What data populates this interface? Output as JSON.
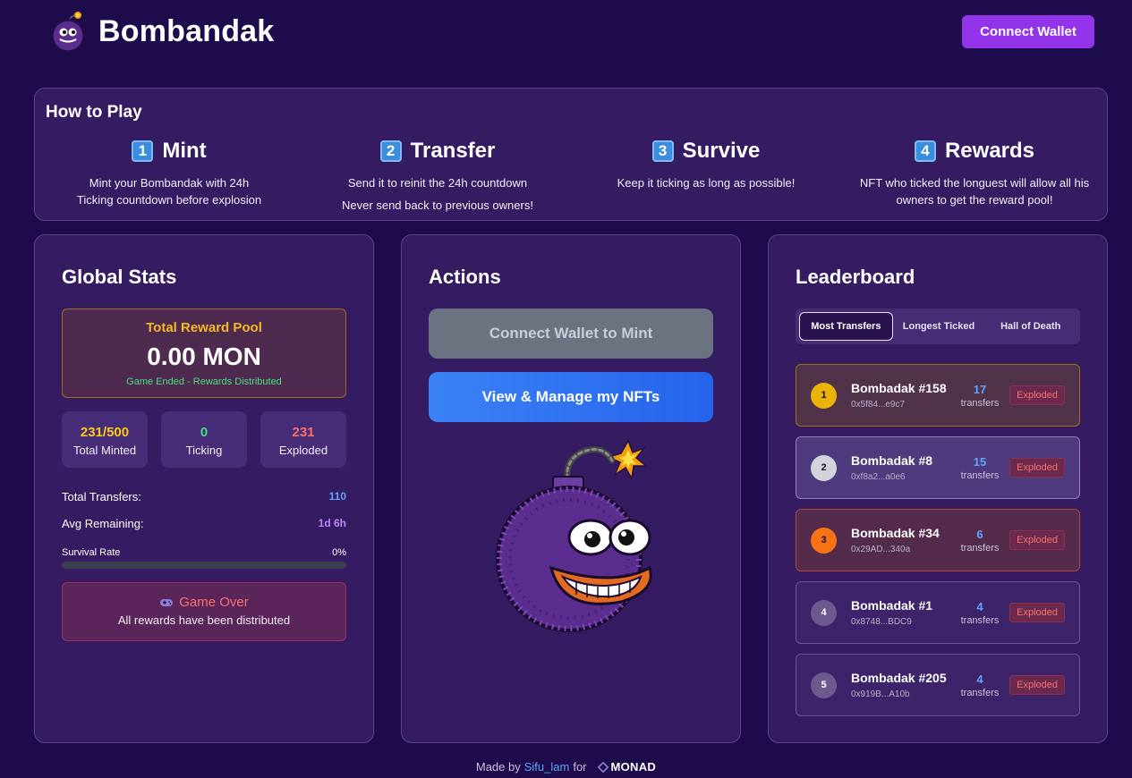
{
  "header": {
    "app_name": "Bombandak",
    "connect_wallet_label": "Connect Wallet"
  },
  "how_to_play": {
    "title": "How to Play",
    "steps": [
      {
        "number": "1",
        "title": "Mint",
        "desc": "Mint your Bombandak with 24h Ticking countdown before explosion",
        "desc2": ""
      },
      {
        "number": "2",
        "title": "Transfer",
        "desc": "Send it to reinit the 24h countdown",
        "desc2": "Never send back to previous owners!"
      },
      {
        "number": "3",
        "title": "Survive",
        "desc": "Keep it ticking as long as possible!",
        "desc2": ""
      },
      {
        "number": "4",
        "title": "Rewards",
        "desc": "NFT who ticked the longuest will allow all his owners to get the reward pool!",
        "desc2": ""
      }
    ]
  },
  "global_stats": {
    "title": "Global Stats",
    "pool_label": "Total Reward Pool",
    "pool_value": "0.00 MON",
    "pool_note": "Game Ended - Rewards Distributed",
    "boxes": [
      {
        "value": "231/500",
        "label": "Total Minted",
        "color": "#facc15"
      },
      {
        "value": "0",
        "label": "Ticking",
        "color": "#4ade80"
      },
      {
        "value": "231",
        "label": "Exploded",
        "color": "#f87171"
      }
    ],
    "total_transfers_label": "Total Transfers:",
    "total_transfers_value": "110",
    "avg_remaining_label": "Avg Remaining:",
    "avg_remaining_value": "1d 6h",
    "survival_rate_label": "Survival Rate",
    "survival_rate_value": "0%",
    "survival_rate_fraction": 0,
    "game_over_title": "Game Over",
    "game_over_desc": "All rewards have been distributed"
  },
  "actions": {
    "title": "Actions",
    "mint_label": "Connect Wallet to Mint",
    "view_label": "View & Manage my NFTs"
  },
  "leaderboard": {
    "title": "Leaderboard",
    "tabs": [
      "Most Transfers",
      "Longest Ticked",
      "Hall of Death"
    ],
    "active_tab": "Most Transfers",
    "entries": [
      {
        "rank": "1",
        "name": "Bombadak #158",
        "address": "0x5f84...e9c7",
        "count": "17",
        "unit": "transfers",
        "status": "Exploded"
      },
      {
        "rank": "2",
        "name": "Bombadak #8",
        "address": "0xf8a2...a0e6",
        "count": "15",
        "unit": "transfers",
        "status": "Exploded"
      },
      {
        "rank": "3",
        "name": "Bombadak #34",
        "address": "0x29AD...340a",
        "count": "6",
        "unit": "transfers",
        "status": "Exploded"
      },
      {
        "rank": "4",
        "name": "Bombadak #1",
        "address": "0x8748...BDC9",
        "count": "4",
        "unit": "transfers",
        "status": "Exploded"
      },
      {
        "rank": "5",
        "name": "Bombadak #205",
        "address": "0x919B...A10b",
        "count": "4",
        "unit": "transfers",
        "status": "Exploded"
      }
    ]
  },
  "footer": {
    "made_by": "Made by",
    "author": "Sifu_lam",
    "for_text": "for",
    "brand": "MONAD"
  },
  "colors": {
    "background": "#1e0b4b",
    "card": "#351b62",
    "accent_purple": "#9333ea",
    "accent_blue": "#3b82f6",
    "gold": "#f5b823"
  }
}
